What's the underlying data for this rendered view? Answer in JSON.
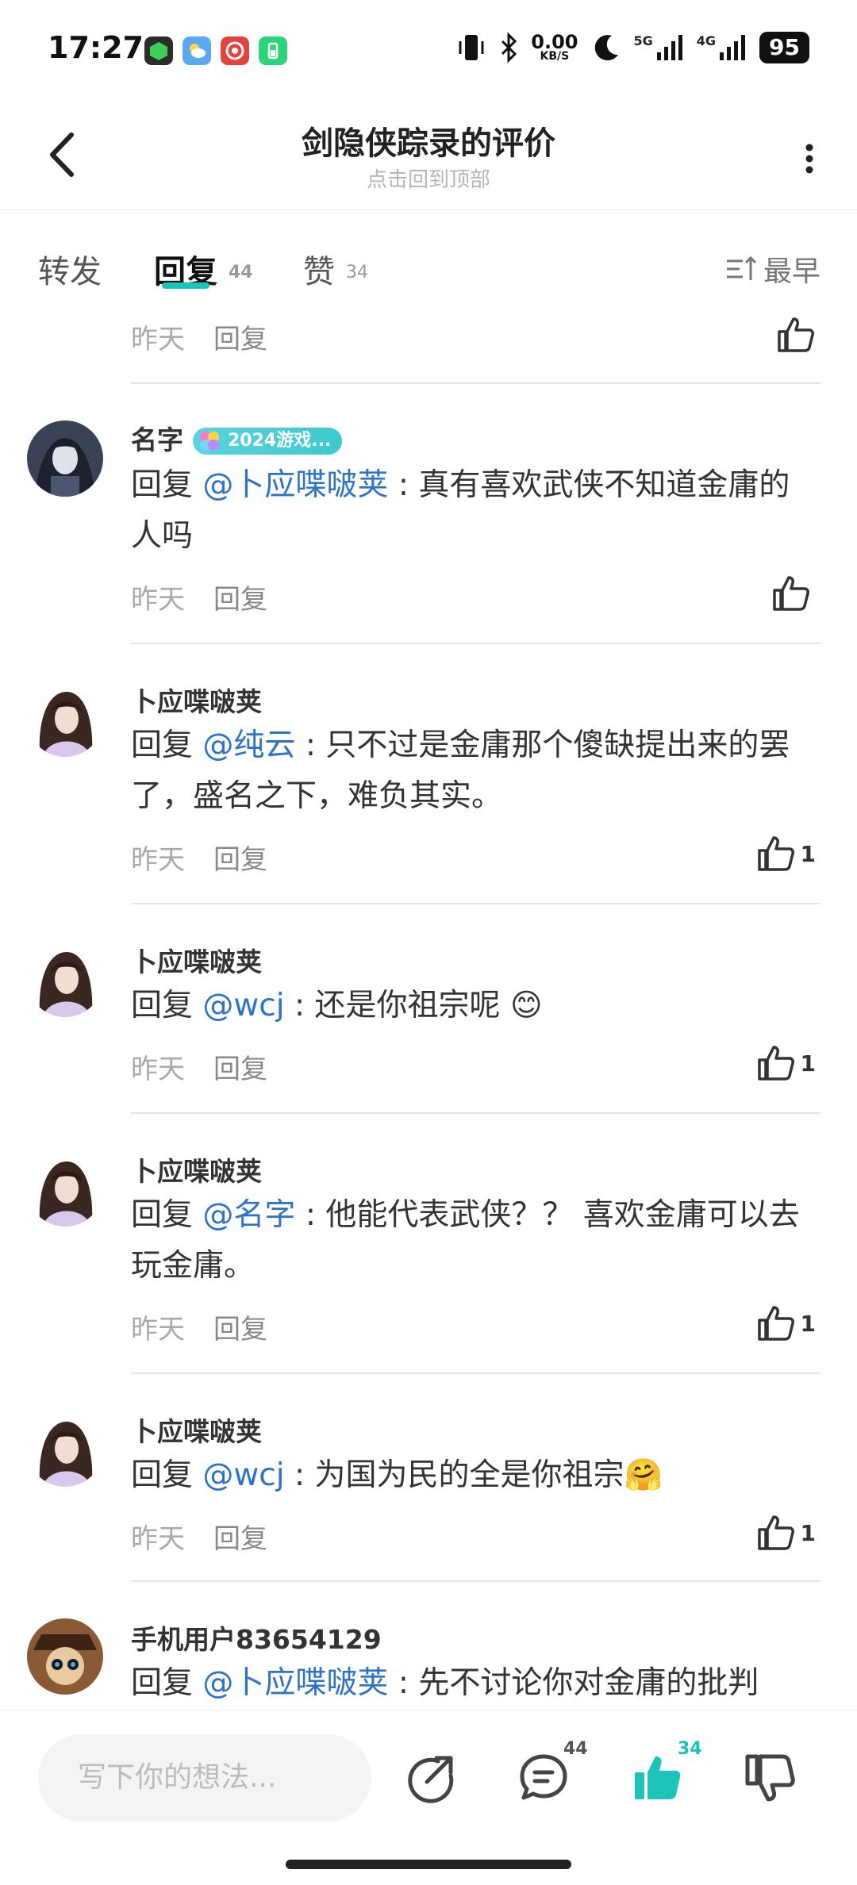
{
  "status_bar": {
    "time": "17:27",
    "net_speed": "0.00",
    "net_unit": "KB/S",
    "signal1": "5G",
    "signal2": "4G",
    "battery": "95"
  },
  "header": {
    "title": "剑隐侠踪录的评价",
    "subtitle": "点击回到顶部"
  },
  "tabs": {
    "repost": "转发",
    "reply": "回复",
    "reply_count": "44",
    "like": "赞",
    "like_count": "34",
    "sort": "最早"
  },
  "colors": {
    "accent": "#1bc3b9",
    "mention": "#2f73c8"
  },
  "top_partial": {
    "time": "昨天",
    "reply": "回复"
  },
  "comments": [
    {
      "name": "名字",
      "badge": "2024游戏...",
      "prefix": "回复 ",
      "mention": "@卜应喋啵荚",
      "text": " : 真有喜欢武侠不知道金庸的人吗",
      "time": "昨天",
      "reply": "回复",
      "likes": ""
    },
    {
      "name": "卜应喋啵荚",
      "prefix": "回复 ",
      "mention": "@纯云",
      "text": " : 只不过是金庸那个傻缺提出来的罢了，盛名之下，难负其实。",
      "time": "昨天",
      "reply": "回复",
      "likes": "1"
    },
    {
      "name": "卜应喋啵荚",
      "prefix": "回复 ",
      "mention": "@wcj",
      "text": " : 还是你祖宗呢 😊",
      "time": "昨天",
      "reply": "回复",
      "likes": "1"
    },
    {
      "name": "卜应喋啵荚",
      "prefix": "回复 ",
      "mention": "@名字",
      "text": " : 他能代表武侠？？  喜欢金庸可以去玩金庸。",
      "time": "昨天",
      "reply": "回复",
      "likes": "1"
    },
    {
      "name": "卜应喋啵荚",
      "prefix": "回复 ",
      "mention": "@wcj",
      "text": " : 为国为民的全是你祖宗🤗",
      "time": "昨天",
      "reply": "回复",
      "likes": "1"
    },
    {
      "name": "手机用户83654129",
      "prefix": "回复 ",
      "mention": "@卜应喋啵荚",
      "text": " : 先不讨论你对金庸的批判",
      "time": "",
      "reply": "",
      "likes": ""
    }
  ],
  "bottom_bar": {
    "placeholder": "写下你的想法...",
    "comment_count": "44",
    "like_count": "34"
  }
}
